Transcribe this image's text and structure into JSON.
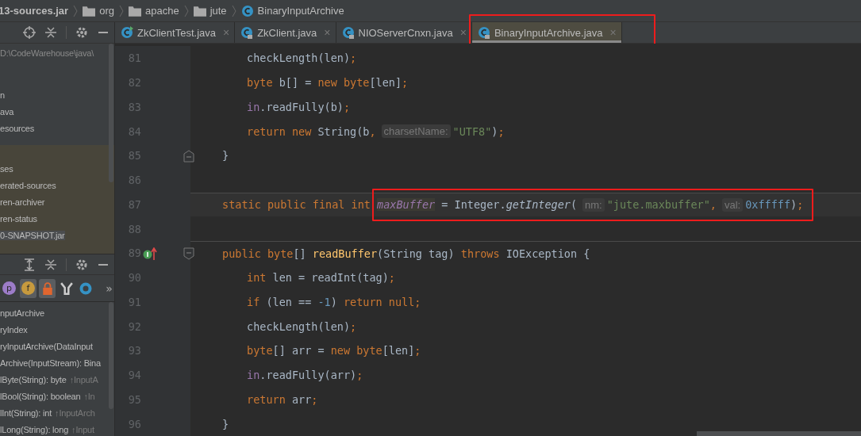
{
  "breadcrumb": [
    {
      "kind": "jar",
      "text": "13-sources.jar"
    },
    {
      "kind": "folder",
      "text": "org"
    },
    {
      "kind": "folder",
      "text": "apache"
    },
    {
      "kind": "folder",
      "text": "jute"
    },
    {
      "kind": "class",
      "text": "BinaryInputArchive"
    }
  ],
  "project_panel": {
    "path": "D:\\CodeWarehouse\\java\\",
    "items": [
      {
        "text": "n",
        "excluded": false,
        "selected": false
      },
      {
        "text": "ava",
        "excluded": false,
        "selected": false
      },
      {
        "text": "esources",
        "excluded": false,
        "selected": false
      },
      {
        "text": "ses",
        "excluded": true,
        "selected": false
      },
      {
        "text": "erated-sources",
        "excluded": true,
        "selected": false
      },
      {
        "text": "ren-archiver",
        "excluded": true,
        "selected": false
      },
      {
        "text": "ren-status",
        "excluded": true,
        "selected": false
      },
      {
        "text": "0-SNAPSHOT.jar",
        "excluded": true,
        "selected": true
      }
    ]
  },
  "structure_panel": {
    "toolbar": [
      {
        "kind": "badge",
        "label": "p",
        "color": "#9c7cc8",
        "selected": false
      },
      {
        "kind": "badge",
        "label": "f",
        "color": "#c79a3e",
        "selected": true
      },
      {
        "kind": "lock",
        "selected": true
      },
      {
        "kind": "filter",
        "selected": false
      },
      {
        "kind": "ring",
        "selected": false
      },
      {
        "kind": "more",
        "label": "»",
        "selected": false
      }
    ],
    "items": [
      {
        "text": "nputArchive"
      },
      {
        "text": "ryIndex"
      },
      {
        "text": "ryInputArchive(DataInput"
      },
      {
        "text": "Archive(InputStream): Bina"
      },
      {
        "text": "lByte(String): byte",
        "inherited": "↑InputA"
      },
      {
        "text": "lBool(String): boolean",
        "inherited": "↑In"
      },
      {
        "text": "lInt(String): int",
        "inherited": "↑InputArch"
      },
      {
        "text": "lLong(String): long",
        "inherited": "↑Input"
      }
    ]
  },
  "tabs": [
    {
      "label": "ZkClientTest.java",
      "kind": "test",
      "close": "×",
      "selected": false,
      "marked": false
    },
    {
      "label": "ZkClient.java",
      "kind": "locked",
      "close": "×",
      "selected": false,
      "marked": false
    },
    {
      "label": "NIOServerCnxn.java",
      "kind": "locked",
      "close": "×",
      "selected": false,
      "marked": false
    },
    {
      "label": "BinaryInputArchive.java",
      "kind": "locked",
      "close": "×",
      "selected": true,
      "marked": true
    }
  ],
  "editor": {
    "lines": [
      {
        "number": "81",
        "kind": "body",
        "tokens": [
          {
            "text": "checkLength(len)",
            "kind": "plain"
          },
          {
            "text": ";",
            "kind": "punct"
          }
        ]
      },
      {
        "number": "82",
        "kind": "body",
        "tokens": [
          {
            "text": "byte",
            "kind": "keyword"
          },
          {
            "text": " b[] = ",
            "kind": "plain"
          },
          {
            "text": "new byte",
            "kind": "keyword"
          },
          {
            "text": "[len]",
            "kind": "plain"
          },
          {
            "text": ";",
            "kind": "punct"
          }
        ]
      },
      {
        "number": "83",
        "kind": "body",
        "tokens": [
          {
            "text": "in",
            "kind": "field"
          },
          {
            "text": ".readFully(b)",
            "kind": "plain"
          },
          {
            "text": ";",
            "kind": "punct"
          }
        ]
      },
      {
        "number": "84",
        "kind": "body",
        "tokens": [
          {
            "text": "return new",
            "kind": "keyword"
          },
          {
            "text": " String(b",
            "kind": "plain"
          },
          {
            "text": ",",
            "kind": "punct"
          },
          {
            "text": "charsetName:",
            "kind": "hint"
          },
          {
            "text": "\"UTF8\"",
            "kind": "string"
          },
          {
            "text": ")",
            "kind": "plain"
          },
          {
            "text": ";",
            "kind": "punct"
          }
        ]
      },
      {
        "number": "85",
        "kind": "member",
        "fold_end": true,
        "tokens": [
          {
            "text": "}",
            "kind": "plain"
          }
        ]
      },
      {
        "number": "86",
        "kind": "blank"
      },
      {
        "number": "87",
        "kind": "member",
        "current": true,
        "separator": true,
        "tokens": [
          {
            "text": "static public final int",
            "kind": "keyword"
          }
        ],
        "marked_tokens": [
          {
            "text": "maxBuffer",
            "kind": "static_field"
          },
          {
            "text": " = Integer.",
            "kind": "plain"
          },
          {
            "text": "getInteger",
            "kind": "static_call"
          },
          {
            "text": "(",
            "kind": "plain"
          },
          {
            "text": "nm:",
            "kind": "hint"
          },
          {
            "text": "\"jute.maxbuffer\"",
            "kind": "string"
          },
          {
            "text": ",",
            "kind": "punct"
          },
          {
            "text": "val:",
            "kind": "hint"
          },
          {
            "text": "0xfffff",
            "kind": "number"
          },
          {
            "text": ")",
            "kind": "plain"
          },
          {
            "text": ";",
            "kind": "punct"
          }
        ]
      },
      {
        "number": "88",
        "kind": "blank"
      },
      {
        "number": "89",
        "kind": "member",
        "fold_start": true,
        "separator": true,
        "implements_marker": true,
        "tokens": [
          {
            "text": "public byte",
            "kind": "keyword"
          },
          {
            "text": "[] ",
            "kind": "plain"
          },
          {
            "text": "readBuffer",
            "kind": "method"
          },
          {
            "text": "(String tag) ",
            "kind": "plain"
          },
          {
            "text": "throws",
            "kind": "keyword"
          },
          {
            "text": " IOException {",
            "kind": "plain"
          }
        ]
      },
      {
        "number": "90",
        "kind": "body",
        "tokens": [
          {
            "text": "int",
            "kind": "keyword"
          },
          {
            "text": " len = readInt(tag)",
            "kind": "plain"
          },
          {
            "text": ";",
            "kind": "punct"
          }
        ]
      },
      {
        "number": "91",
        "kind": "body",
        "tokens": [
          {
            "text": "if",
            "kind": "keyword"
          },
          {
            "text": " (len == ",
            "kind": "plain"
          },
          {
            "text": "-1",
            "kind": "number"
          },
          {
            "text": ") ",
            "kind": "plain"
          },
          {
            "text": "return null",
            "kind": "keyword"
          },
          {
            "text": ";",
            "kind": "punct"
          }
        ]
      },
      {
        "number": "92",
        "kind": "body",
        "tokens": [
          {
            "text": "checkLength(len)",
            "kind": "plain"
          },
          {
            "text": ";",
            "kind": "punct"
          }
        ]
      },
      {
        "number": "93",
        "kind": "body",
        "tokens": [
          {
            "text": "byte",
            "kind": "keyword"
          },
          {
            "text": "[] arr = ",
            "kind": "plain"
          },
          {
            "text": "new byte",
            "kind": "keyword"
          },
          {
            "text": "[len]",
            "kind": "plain"
          },
          {
            "text": ";",
            "kind": "punct"
          }
        ]
      },
      {
        "number": "94",
        "kind": "body",
        "tokens": [
          {
            "text": "in",
            "kind": "field"
          },
          {
            "text": ".readFully(arr)",
            "kind": "plain"
          },
          {
            "text": ";",
            "kind": "punct"
          }
        ]
      },
      {
        "number": "95",
        "kind": "body",
        "tokens": [
          {
            "text": "return",
            "kind": "keyword"
          },
          {
            "text": " arr",
            "kind": "plain"
          },
          {
            "text": ";",
            "kind": "punct"
          }
        ]
      },
      {
        "number": "96",
        "kind": "member",
        "tokens": [
          {
            "text": "}",
            "kind": "plain"
          }
        ]
      }
    ]
  }
}
